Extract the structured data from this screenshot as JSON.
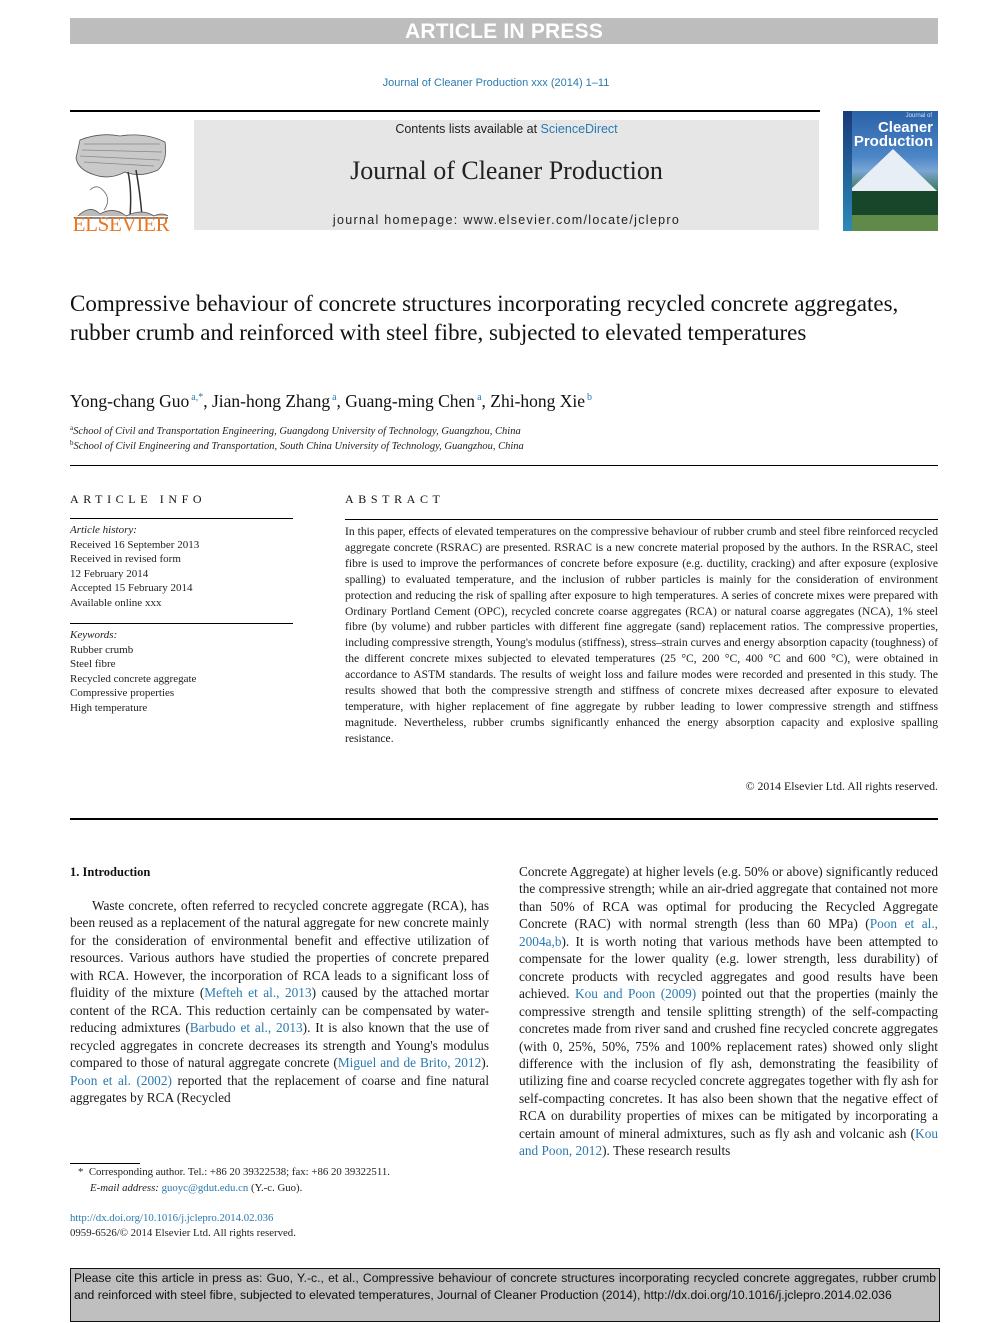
{
  "banner": {
    "text": "ARTICLE IN PRESS"
  },
  "journal_ref": "Journal of Cleaner Production xxx (2014) 1–11",
  "masthead": {
    "publisher_logo_text": "ELSEVIER",
    "contents_prefix": "Contents lists available at ",
    "contents_link": "ScienceDirect",
    "journal_title": "Journal of Cleaner Production",
    "homepage_prefix": "journal homepage: ",
    "homepage_url": "www.elsevier.com/locate/jclepro",
    "cover": {
      "small_text": "Journal of",
      "title_line1": "Cleaner",
      "title_line2": "Production"
    }
  },
  "article": {
    "title": "Compressive behaviour of concrete structures incorporating recycled concrete aggregates, rubber crumb and reinforced with steel fibre, subjected to elevated temperatures",
    "authors": [
      {
        "name": "Yong-chang Guo",
        "sup": "a,*"
      },
      {
        "name": "Jian-hong Zhang",
        "sup": "a"
      },
      {
        "name": "Guang-ming Chen",
        "sup": "a"
      },
      {
        "name": "Zhi-hong Xie",
        "sup": "b"
      }
    ],
    "affiliations": [
      {
        "label": "a",
        "text": "School of Civil and Transportation Engineering, Guangdong University of Technology, Guangzhou, China"
      },
      {
        "label": "b",
        "text": "School of Civil Engineering and Transportation, South China University of Technology, Guangzhou, China"
      }
    ]
  },
  "article_info": {
    "heading": "ARTICLE INFO",
    "history_label": "Article history:",
    "history": [
      "Received 16 September 2013",
      "Received in revised form",
      "12 February 2014",
      "Accepted 15 February 2014",
      "Available online xxx"
    ],
    "keywords_label": "Keywords:",
    "keywords": [
      "Rubber crumb",
      "Steel fibre",
      "Recycled concrete aggregate",
      "Compressive properties",
      "High temperature"
    ]
  },
  "abstract": {
    "heading": "ABSTRACT",
    "text": "In this paper, effects of elevated temperatures on the compressive behaviour of rubber crumb and steel fibre reinforced recycled aggregate concrete (RSRAC) are presented. RSRAC is a new concrete material proposed by the authors. In the RSRAC, steel fibre is used to improve the performances of concrete before exposure (e.g. ductility, cracking) and after exposure (explosive spalling) to evaluated temperature, and the inclusion of rubber particles is mainly for the consideration of environment protection and reducing the risk of spalling after exposure to high temperatures. A series of concrete mixes were prepared with Ordinary Portland Cement (OPC), recycled concrete coarse aggregates (RCA) or natural coarse aggregates (NCA), 1% steel fibre (by volume) and rubber particles with different fine aggregate (sand) replacement ratios. The compressive properties, including compressive strength, Young's modulus (stiffness), stress–strain curves and energy absorption capacity (toughness) of the different concrete mixes subjected to elevated temperatures (25 °C, 200 °C, 400 °C and 600 °C), were obtained in accordance to ASTM standards. The results of weight loss and failure modes were recorded and presented in this study. The results showed that both the compressive strength and stiffness of concrete mixes decreased after exposure to elevated temperature, with higher replacement of fine aggregate by rubber leading to lower compressive strength and stiffness magnitude. Nevertheless, rubber crumbs significantly enhanced the energy absorption capacity and explosive spalling resistance.",
    "copyright": "© 2014 Elsevier Ltd. All rights reserved."
  },
  "intro": {
    "heading": "1.  Introduction",
    "left": {
      "t1": "Waste concrete, often referred to recycled concrete aggregate (RCA), has been reused as a replacement of the natural aggregate for new concrete mainly for the consideration of environmental benefit and effective utilization of resources. Various authors have studied the properties of concrete prepared with RCA. However, the incorporation of RCA leads to a significant loss of fluidity of the mixture (",
      "c1": "Mefteh et al., 2013",
      "t2": ") caused by the attached mortar content of the RCA. This reduction certainly can be compensated by water-reducing admixtures (",
      "c2": "Barbudo et al., 2013",
      "t3": "). It is also known that the use of recycled aggregates in concrete decreases its strength and Young's modulus compared to those of natural aggregate concrete (",
      "c3": "Miguel and de Brito, 2012",
      "t4": "). ",
      "c4": "Poon et al. (2002)",
      "t5": " reported that the replacement of coarse and fine natural aggregates by RCA (Recycled"
    },
    "right": {
      "t1": "Concrete Aggregate) at higher levels (e.g. 50% or above) significantly reduced the compressive strength; while an air-dried aggregate that contained not more than 50% of RCA was optimal for producing the Recycled Aggregate Concrete (RAC) with normal strength (less than 60 MPa) (",
      "c1": "Poon et al., 2004a,b",
      "t2": "). It is worth noting that various methods have been attempted to compensate for the lower quality (e.g. lower strength, less durability) of concrete products with recycled aggregates and good results have been achieved. ",
      "c2": "Kou and Poon (2009)",
      "t3": " pointed out that the properties (mainly the compressive strength and tensile splitting strength) of the self-compacting concretes made from river sand and crushed fine recycled concrete aggregates (with 0, 25%, 50%, 75% and 100% replacement rates) showed only slight difference with the inclusion of fly ash, demonstrating the feasibility of utilizing fine and coarse recycled concrete aggregates together with fly ash for self-compacting concretes. It has also been shown that the negative effect of RCA on durability properties of mixes can be mitigated by incorporating a certain amount of mineral admixtures, such as fly ash and volcanic ash (",
      "c3": "Kou and Poon, 2012",
      "t4": "). These research results"
    }
  },
  "footnote": {
    "marker": "*",
    "corresponding": "Corresponding author. Tel.: +86 20 39322538; fax: +86 20 39322511.",
    "email_label": "E-mail address:",
    "email": "guoyc@gdut.edu.cn",
    "email_suffix": " (Y.-c. Guo)."
  },
  "doi": {
    "url": "http://dx.doi.org/10.1016/j.jclepro.2014.02.036",
    "issn_line": "0959-6526/© 2014 Elsevier Ltd. All rights reserved."
  },
  "cite_box": {
    "text": "Please cite this article in press as: Guo, Y.-c., et al., Compressive behaviour of concrete structures incorporating recycled concrete aggregates, rubber crumb and reinforced with steel fibre, subjected to elevated temperatures, Journal of Cleaner Production (2014), http://dx.doi.org/10.1016/j.jclepro.2014.02.036"
  },
  "colors": {
    "link": "#2a7ab0",
    "elsevier_orange": "#e87722",
    "banner_gray": "#bdbdbd",
    "masthead_gray": "#e6e6e6"
  }
}
